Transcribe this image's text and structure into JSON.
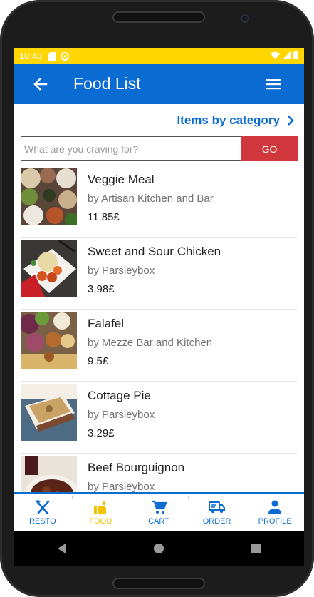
{
  "status_bar": {
    "time": "10:40"
  },
  "app_bar": {
    "title": "Food List"
  },
  "category_link": {
    "label": "Items by category"
  },
  "search": {
    "placeholder": "What are you craving for?",
    "value": "",
    "button_label": "GO"
  },
  "items": [
    {
      "name": "Veggie Meal",
      "vendor": "by Artisan Kitchen and Bar",
      "price": "11.85£"
    },
    {
      "name": "Sweet and Sour Chicken",
      "vendor": "by Parsleybox",
      "price": "3.98£"
    },
    {
      "name": "Falafel",
      "vendor": "by Mezze Bar and Kitchen",
      "price": "9.5£"
    },
    {
      "name": "Cottage Pie",
      "vendor": "by Parsleybox",
      "price": "3.29£"
    },
    {
      "name": "Beef Bourguignon",
      "vendor": "by Parsleybox",
      "price": ""
    }
  ],
  "bottom_nav": {
    "active": "FOOD",
    "items": [
      {
        "label": "RESTO",
        "icon": "cutlery-icon"
      },
      {
        "label": "FOOD",
        "icon": "food-icon"
      },
      {
        "label": "CART",
        "icon": "cart-icon"
      },
      {
        "label": "ORDER",
        "icon": "truck-icon"
      },
      {
        "label": "PROFILE",
        "icon": "person-icon"
      }
    ]
  },
  "colors": {
    "status_bar": "#ffd600",
    "primary": "#0a6bd3",
    "go_button": "#d0383d",
    "active_nav": "#f3c200"
  }
}
